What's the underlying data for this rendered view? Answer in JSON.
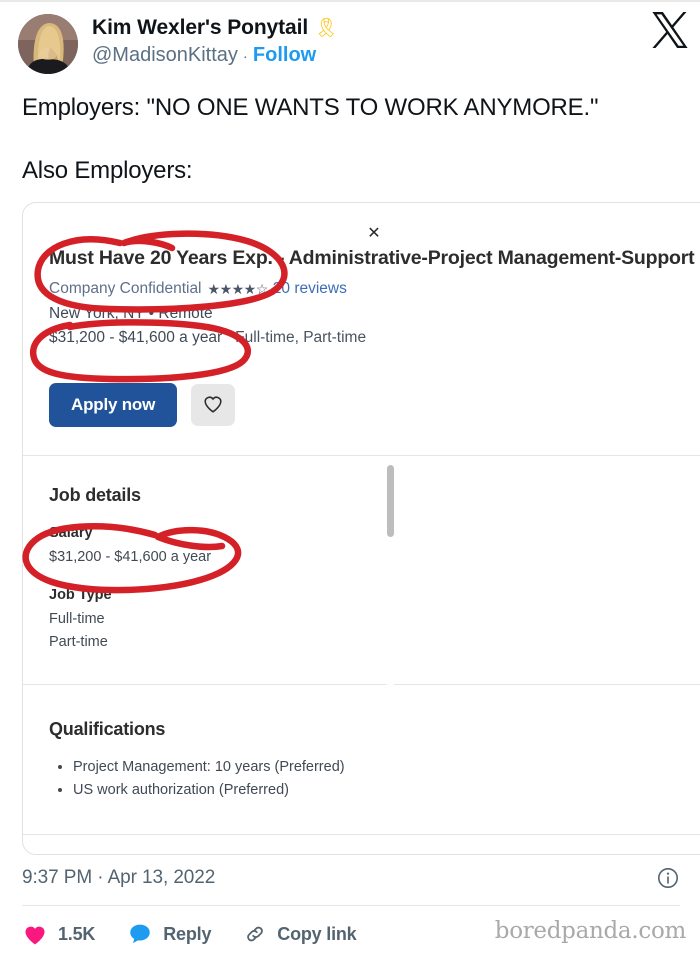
{
  "tweet": {
    "display_name": "Kim Wexler's Ponytail",
    "name_emoji": "🎗",
    "handle": "@MadisonKittay",
    "separator": "·",
    "follow_label": "Follow",
    "platform_logo": "x-logo",
    "body_line_1": "Employers: \"NO ONE WANTS TO WORK ANYMORE.\"",
    "body_line_2": "Also Employers:",
    "timestamp": "9:37 PM · Apr 13, 2022",
    "info_icon": "info-circle-icon"
  },
  "engagement": {
    "like_icon": "heart-icon",
    "like_count": "1.5K",
    "reply_icon": "speech-bubble-icon",
    "reply_label": "Reply",
    "link_icon": "link-icon",
    "copy_link_label": "Copy link"
  },
  "watermark": "boredpanda.com",
  "job_card": {
    "close_icon": "close-icon",
    "title": "Must Have 20 Years Exp. - Administrative-Project Management-Support",
    "company": "Company Confidential",
    "stars": "★★★★☆",
    "rating_value": "3.5",
    "reviews": "20 reviews",
    "location": "New York, NY  •  Remote",
    "pay": "$31,200 - $41,600 a year",
    "employment_types": "Full-time, Part-time",
    "apply_label": "Apply now",
    "save_icon": "heart-outline-icon",
    "details": {
      "heading": "Job details",
      "salary_label": "Salary",
      "salary_value": "$31,200 - $41,600 a year",
      "job_type_label": "Job Type",
      "job_type_1": "Full-time",
      "job_type_2": "Part-time"
    },
    "qualifications": {
      "heading": "Qualifications",
      "items": [
        "Project Management: 10 years (Preferred)",
        "US work authorization (Preferred)"
      ]
    }
  },
  "annotations": {
    "color": "#d42027",
    "circle_1_target": "Must Have 20 Years Exp.",
    "circle_2_target": "New York, NY • Remote / $31,200 - $41,600 a year",
    "circle_3_target": "Salary $31,200 - $41,600 a year"
  },
  "colors": {
    "link_blue": "#1d9bf0",
    "apply_blue": "#21539b",
    "like_pink": "#f91880",
    "reply_blue": "#1d9bf0",
    "annotation_red": "#d42027",
    "text_dark": "#0f1419",
    "text_muted": "#536471"
  }
}
